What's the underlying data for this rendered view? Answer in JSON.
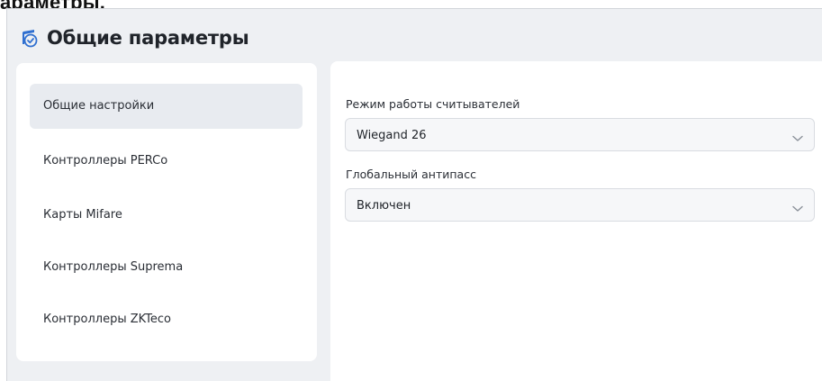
{
  "doc_heading_fragment": "араметры.",
  "header": {
    "title": "Общие параметры",
    "icon": "shield-check-icon"
  },
  "sidebar": {
    "items": [
      {
        "label": "Общие настройки",
        "active": true
      },
      {
        "label": "Контроллеры PERCo",
        "active": false
      },
      {
        "label": "Карты Mifare",
        "active": false
      },
      {
        "label": "Контроллеры Suprema",
        "active": false
      },
      {
        "label": "Контроллеры ZKTeco",
        "active": false
      }
    ]
  },
  "main": {
    "fields": [
      {
        "label": "Режим работы считывателей",
        "value": "Wiegand 26",
        "icon": "chevron-down-icon"
      },
      {
        "label": "Глобальный антипасс",
        "value": "Включен",
        "icon": "chevron-down-icon"
      }
    ]
  },
  "colors": {
    "accent": "#2f6fd0",
    "background": "#eef0f3",
    "active_item": "#e8ebf0"
  }
}
